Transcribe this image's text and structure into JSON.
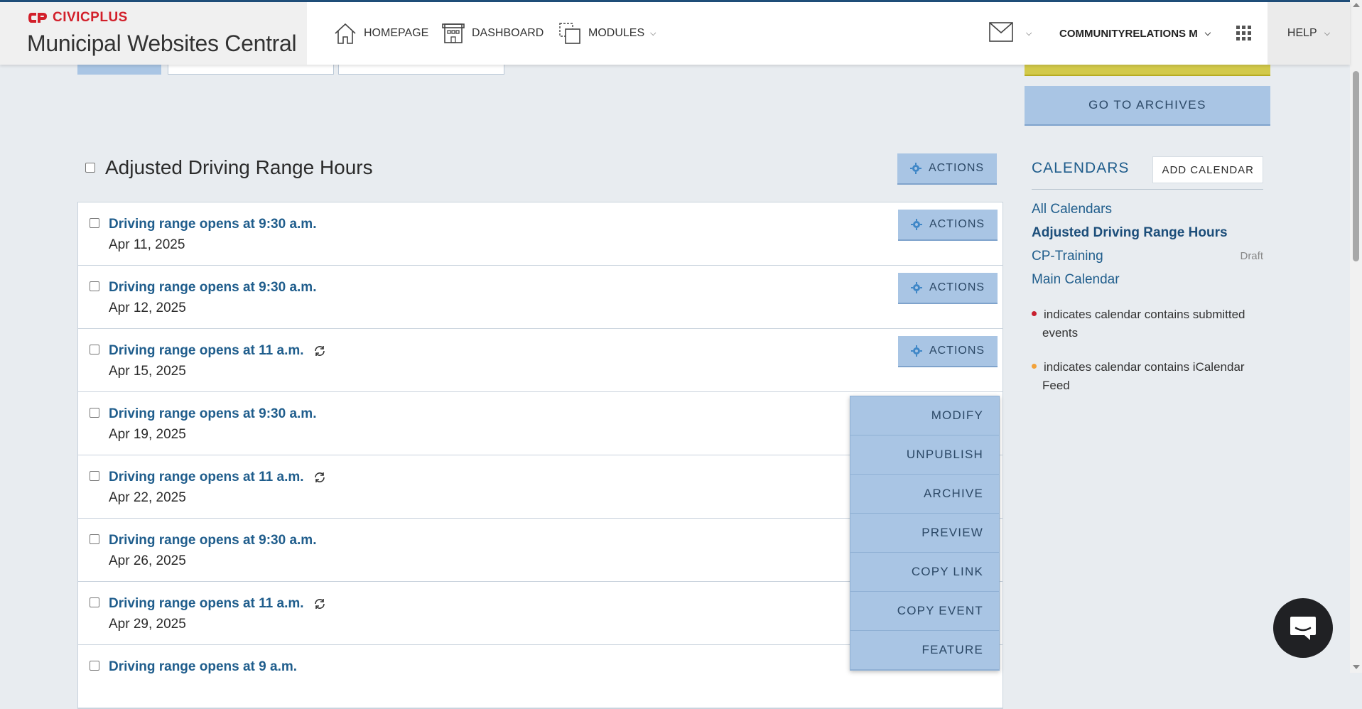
{
  "header": {
    "brand_name": "CIVICPLUS",
    "site_title": "Municipal Websites Central",
    "nav": [
      {
        "label": "HOMEPAGE",
        "icon": "home-icon"
      },
      {
        "label": "DASHBOARD",
        "icon": "dashboard-icon"
      },
      {
        "label": "MODULES",
        "icon": "modules-icon"
      }
    ],
    "user": "COMMUNITYRELATIONS M",
    "help": "HELP"
  },
  "main": {
    "calendar_title": "Adjusted Driving Range Hours",
    "actions_label": "ACTIONS",
    "events": [
      {
        "title": "Driving range opens at 9:30 a.m.",
        "date": "Apr 11, 2025",
        "recurring": false
      },
      {
        "title": "Driving range opens at 9:30 a.m.",
        "date": "Apr 12, 2025",
        "recurring": false
      },
      {
        "title": "Driving range opens at 11 a.m.",
        "date": "Apr 15, 2025",
        "recurring": true
      },
      {
        "title": "Driving range opens at 9:30 a.m.",
        "date": "Apr 19, 2025",
        "recurring": false
      },
      {
        "title": "Driving range opens at 11 a.m.",
        "date": "Apr 22, 2025",
        "recurring": true
      },
      {
        "title": "Driving range opens at 9:30 a.m.",
        "date": "Apr 26, 2025",
        "recurring": false
      },
      {
        "title": "Driving range opens at 11 a.m.",
        "date": "Apr 29, 2025",
        "recurring": true
      },
      {
        "title": "Driving range opens at 9 a.m.",
        "date": "",
        "recurring": false
      }
    ],
    "actions_menu": [
      "MODIFY",
      "UNPUBLISH",
      "ARCHIVE",
      "PREVIEW",
      "COPY LINK",
      "COPY EVENT",
      "FEATURE"
    ]
  },
  "sidebar": {
    "archives_button": "GO TO ARCHIVES",
    "calendars_heading": "CALENDARS",
    "add_calendar": "ADD CALENDAR",
    "calendars": [
      {
        "label": "All Calendars",
        "status": ""
      },
      {
        "label": "Adjusted Driving Range Hours",
        "status": ""
      },
      {
        "label": "CP-Training",
        "status": "Draft"
      },
      {
        "label": "Main Calendar",
        "status": ""
      }
    ],
    "legend": [
      {
        "text": "indicates calendar contains submitted events",
        "color": "#c8202f"
      },
      {
        "text": "indicates calendar contains iCalendar Feed",
        "color": "#f2a23a"
      }
    ]
  },
  "colors": {
    "brand_red": "#d21f2a",
    "link_blue": "#1f5d8c",
    "button_blue": "#a9c5e4",
    "page_bg": "#e8ecf0"
  }
}
